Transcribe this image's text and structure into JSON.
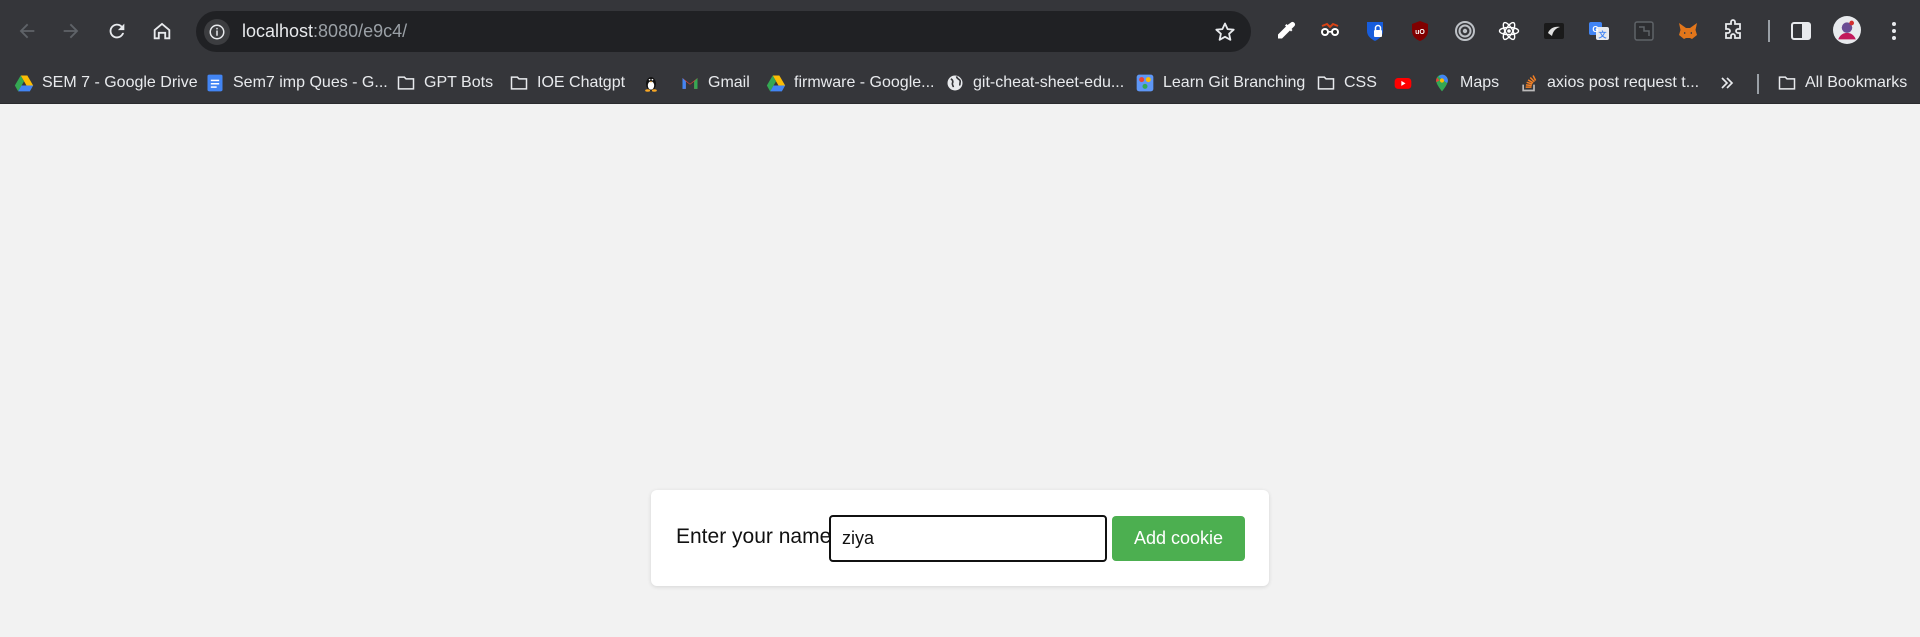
{
  "browser": {
    "url_host": "localhost",
    "url_rest": ":8080/e9c4/",
    "nav": {
      "back_icon": "arrow-left-icon",
      "forward_icon": "arrow-right-icon",
      "reload_icon": "reload-icon",
      "home_icon": "home-icon"
    },
    "extensions": [
      "eyedropper-icon",
      "glasses-icon",
      "bitwarden-icon",
      "ublock-icon",
      "target-icon",
      "react-icon",
      "dark-mode-icon",
      "translate-icon",
      "puzzle-box-icon",
      "metamask-icon",
      "extensions-puzzle-icon"
    ],
    "colors": {
      "toolbar": "#35363a",
      "omnibox": "#202124",
      "text": "#e8eaed",
      "dim_text": "#9aa0a6"
    }
  },
  "bookmarks": [
    {
      "label": "SEM 7 - Google Drive",
      "icon": "google-drive-icon"
    },
    {
      "label": "Sem7 imp Ques - G...",
      "icon": "google-docs-icon"
    },
    {
      "label": "GPT Bots",
      "icon": "folder-icon"
    },
    {
      "label": "IOE Chatgpt",
      "icon": "folder-icon"
    },
    {
      "label": "",
      "icon": "linux-penguin-icon"
    },
    {
      "label": "Gmail",
      "icon": "gmail-icon"
    },
    {
      "label": "firmware - Google...",
      "icon": "google-drive-icon"
    },
    {
      "label": "git-cheat-sheet-edu...",
      "icon": "globe-icon"
    },
    {
      "label": "Learn Git Branching",
      "icon": "git-branching-icon"
    },
    {
      "label": "CSS",
      "icon": "folder-icon"
    },
    {
      "label": "",
      "icon": "youtube-icon"
    },
    {
      "label": "Maps",
      "icon": "google-maps-icon"
    },
    {
      "label": "axios post request t...",
      "icon": "stackoverflow-icon"
    }
  ],
  "bookmarks_more_icon": "chevron-double-right-icon",
  "all_bookmarks_label": "All Bookmarks",
  "page": {
    "label": "Enter your name:",
    "input_value": "ziya",
    "button_label": "Add cookie",
    "accent_color": "#4caf50"
  }
}
